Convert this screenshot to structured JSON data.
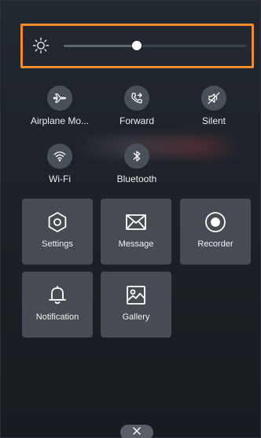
{
  "brightness": {
    "level": 0.4,
    "icon": "sun-icon"
  },
  "toggles_row1": [
    {
      "label": "Airplane Mo...",
      "icon": "airplane-icon"
    },
    {
      "label": "Forward",
      "icon": "forward-call-icon"
    },
    {
      "label": "Silent",
      "icon": "silent-icon"
    }
  ],
  "toggles_row2": [
    {
      "label": "Wi-Fi",
      "icon": "wifi-icon"
    },
    {
      "label": "Bluetooth",
      "icon": "bluetooth-icon"
    }
  ],
  "tiles": [
    {
      "label": "Settings",
      "icon": "settings-icon"
    },
    {
      "label": "Message",
      "icon": "message-icon"
    },
    {
      "label": "Recorder",
      "icon": "recorder-icon"
    },
    {
      "label": "Notification",
      "icon": "notification-bell-icon"
    },
    {
      "label": "Gallery",
      "icon": "gallery-icon"
    }
  ],
  "close": {
    "icon": "close-icon"
  },
  "colors": {
    "highlight_border": "#f28a2e",
    "tile_bg": "#484c52",
    "toggle_bg": "#4a5058"
  }
}
